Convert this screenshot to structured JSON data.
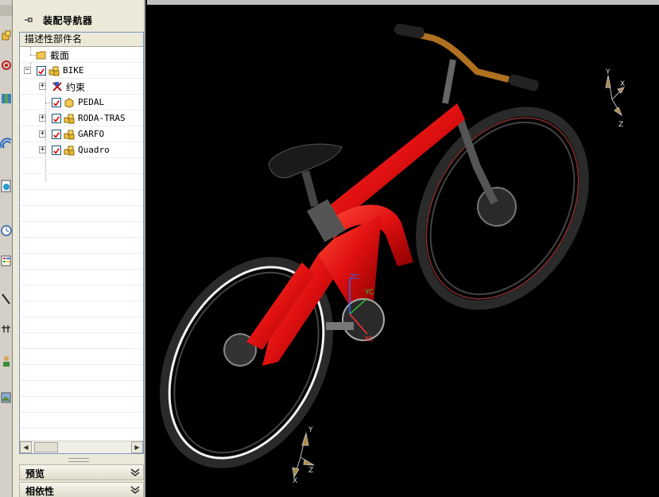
{
  "navigator": {
    "title": "装配导航器",
    "column_header": "描述性部件名",
    "tree": [
      {
        "label": "截面",
        "icon": "folder-icon",
        "checked": null,
        "expandable": false,
        "level": 0
      },
      {
        "label": "BIKE",
        "icon": "assembly-icon",
        "checked": true,
        "expandable": true,
        "expanded": true,
        "level": 0
      },
      {
        "label": "约束",
        "icon": "constraints-icon",
        "checked": null,
        "expandable": true,
        "expanded": false,
        "level": 1
      },
      {
        "label": "PEDAL",
        "icon": "part-icon",
        "checked": true,
        "expandable": false,
        "level": 1
      },
      {
        "label": "RODA-TRAS",
        "icon": "assembly-icon",
        "checked": true,
        "expandable": true,
        "expanded": false,
        "level": 1
      },
      {
        "label": "GARFO",
        "icon": "assembly-icon",
        "checked": true,
        "expandable": true,
        "expanded": false,
        "level": 1
      },
      {
        "label": "Quadro",
        "icon": "assembly-icon",
        "checked": true,
        "expandable": true,
        "expanded": false,
        "level": 1
      }
    ],
    "sections": [
      {
        "label": "预览"
      },
      {
        "label": "相依性"
      }
    ]
  },
  "viewport": {
    "view_triad_labels": {
      "x": "X",
      "y": "Y",
      "z": "Z"
    },
    "wcs_labels": {
      "x": "XC",
      "y": "YC",
      "z": "ZC"
    },
    "bottom_triad_labels": {
      "x": "X",
      "y": "Y",
      "z": "Z"
    },
    "frame_color": "#e01010",
    "background": "#000000"
  }
}
